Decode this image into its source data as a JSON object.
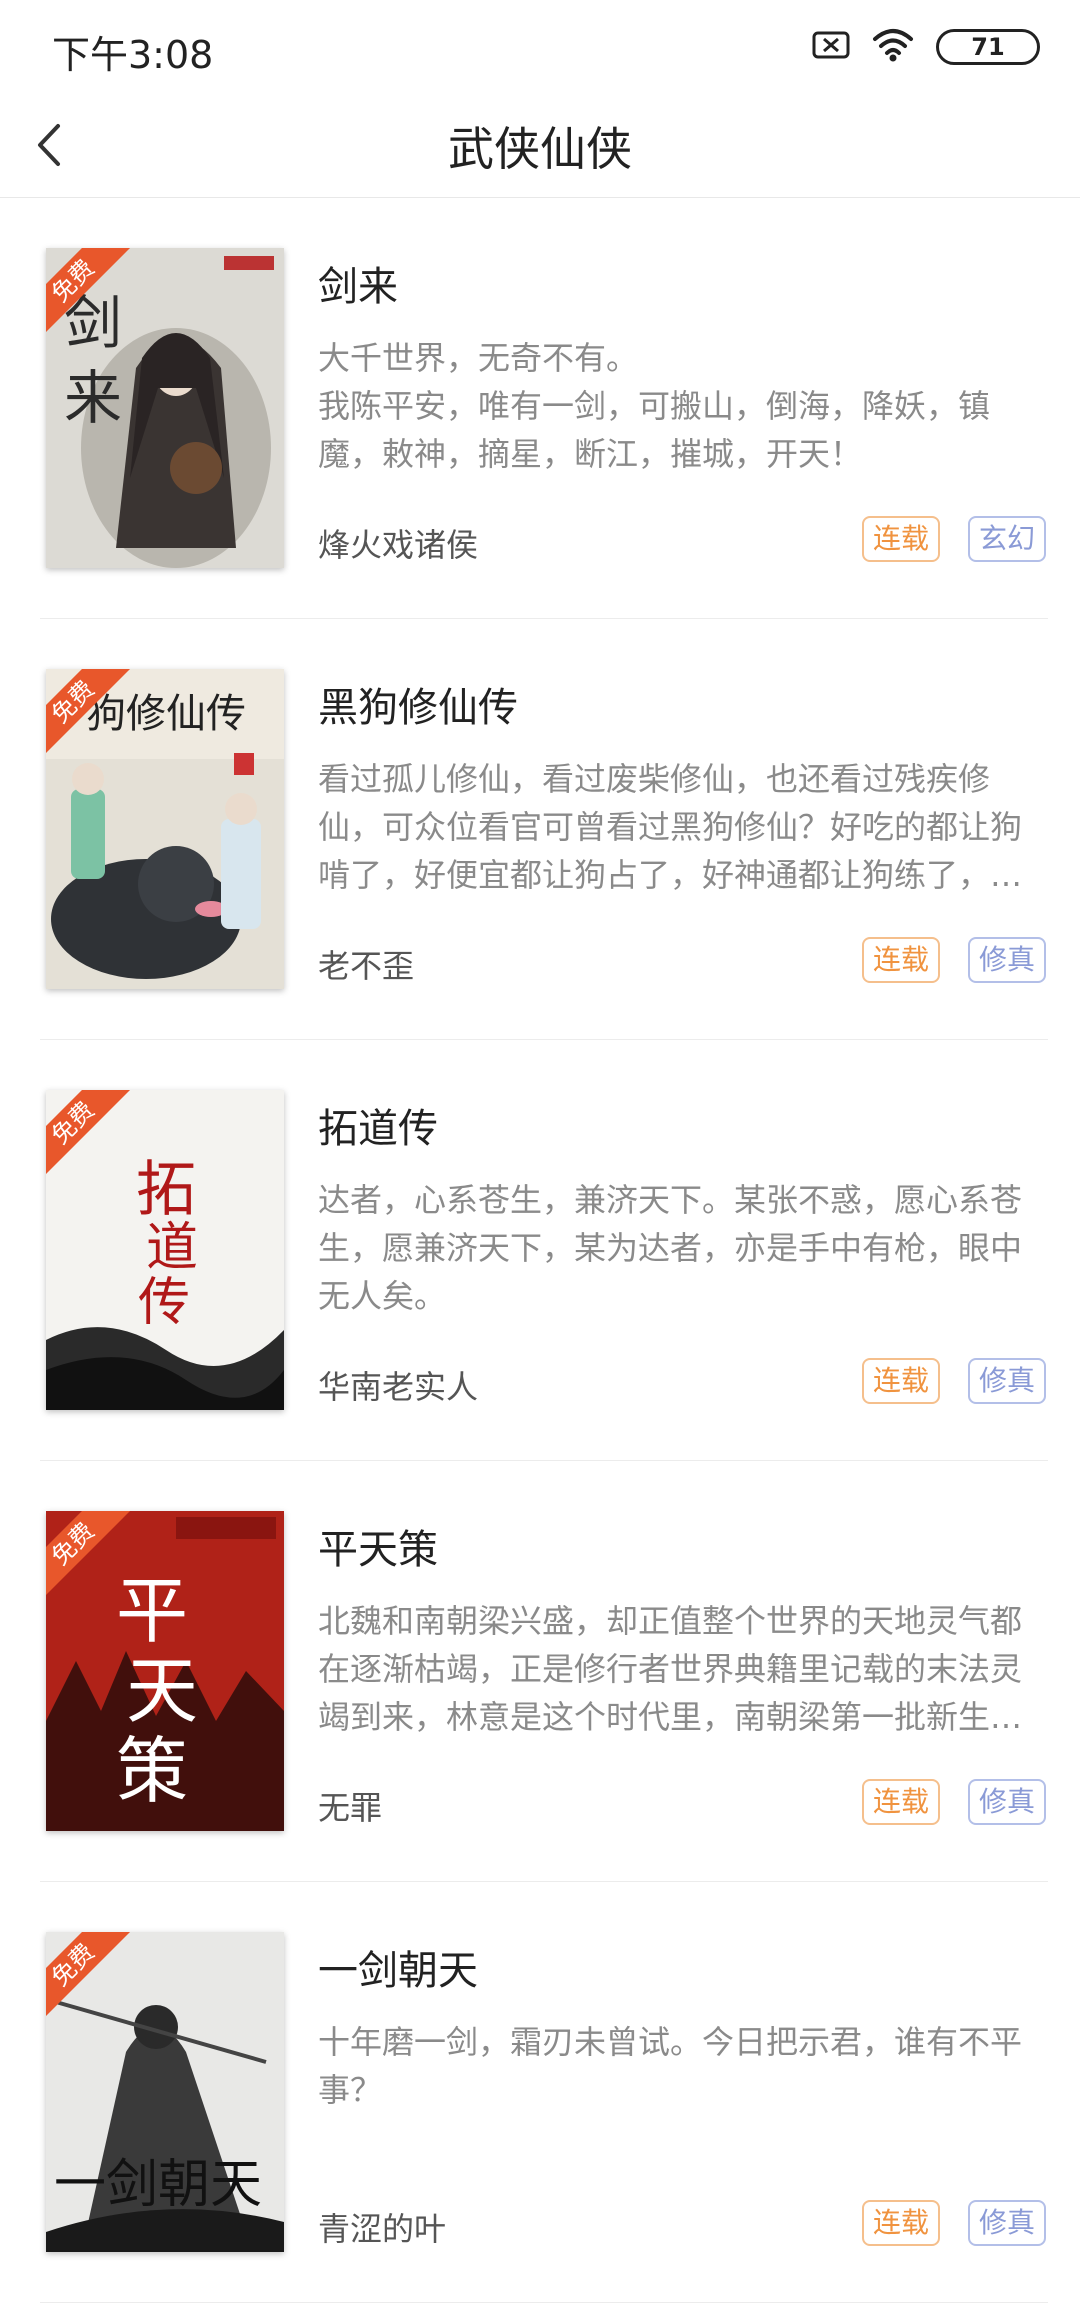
{
  "status_bar": {
    "time": "下午3:08",
    "battery": "71",
    "icons": [
      "sim-off-icon",
      "wifi-icon",
      "battery-icon"
    ]
  },
  "nav": {
    "title": "武侠仙侠",
    "back_icon": "back-chevron-icon"
  },
  "colors": {
    "status_tag": "#f0933f",
    "genre_tag": "#8a9ad6",
    "free_badge": "#e8572b",
    "desc_text": "#8a8a8a"
  },
  "books": [
    {
      "title": "剑来",
      "desc": "大千世界，无奇不有。\n我陈平安，唯有一剑，可搬山，倒海，降妖，镇魔，敕神，摘星，断江，摧城，开天！",
      "author": "烽火戏诸侯",
      "status": "连载",
      "genre": "玄幻",
      "badge": "免费"
    },
    {
      "title": "黑狗修仙传",
      "desc": "看过孤儿修仙，看过废柴修仙，也还看过残疾修仙，可众位看官可曾看过黑狗修仙？好吃的都让狗啃了，好便宜都让狗占了，好神通都让狗练了，好处都让狗得了",
      "author": "老不歪",
      "status": "连载",
      "genre": "修真",
      "badge": "免费"
    },
    {
      "title": "拓道传",
      "desc": "达者，心系苍生，兼济天下。某张不惑，愿心系苍生，愿兼济天下，某为达者，亦是手中有枪，眼中无人矣。",
      "author": "华南老实人",
      "status": "连载",
      "genre": "修真",
      "badge": "免费"
    },
    {
      "title": "平天策",
      "desc": "北魏和南朝梁兴盛，却正值整个世界的天地灵气都在逐渐枯竭，正是修行者世界典籍里记载的末法灵竭到来，林意是这个时代里，南朝梁第一批新生的修行者",
      "author": "无罪",
      "status": "连载",
      "genre": "修真",
      "badge": "免费"
    },
    {
      "title": "一剑朝天",
      "desc": "十年磨一剑，霜刃未曾试。今日把示君，谁有不平事？",
      "author": "青涩的叶",
      "status": "连载",
      "genre": "修真",
      "badge": "免费"
    }
  ]
}
